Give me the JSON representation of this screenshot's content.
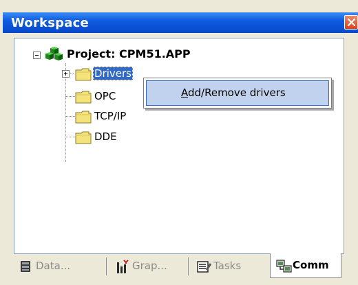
{
  "window": {
    "title": "Workspace",
    "close_icon": "close-icon",
    "accent_color": "#0a53d6"
  },
  "tree": {
    "root": {
      "label": "Project: CPM51.APP",
      "icon": "project-cubes-icon",
      "expanded": true
    },
    "children": [
      {
        "label": "Drivers",
        "icon": "folder-icon",
        "has_children": true,
        "selected": true
      },
      {
        "label": "OPC",
        "icon": "folder-icon",
        "has_children": false,
        "selected": false
      },
      {
        "label": "TCP/IP",
        "icon": "folder-icon",
        "has_children": false,
        "selected": false
      },
      {
        "label": "DDE",
        "icon": "folder-icon",
        "has_children": false,
        "selected": false
      }
    ]
  },
  "context_menu": {
    "items": [
      {
        "label_accel": "A",
        "label_rest": "dd/Remove drivers",
        "highlighted": true
      }
    ]
  },
  "tabs": [
    {
      "label": "Data...",
      "icon": "database-icon",
      "active": false
    },
    {
      "label": "Grap...",
      "icon": "graphics-icon",
      "active": false
    },
    {
      "label": "Tasks",
      "icon": "tasks-icon",
      "active": false
    },
    {
      "label": "Comm",
      "icon": "communication-icon",
      "active": true
    }
  ]
}
